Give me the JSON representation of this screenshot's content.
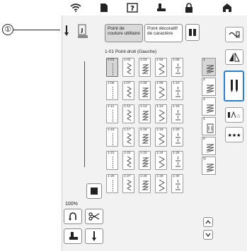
{
  "callout": {
    "number": "①"
  },
  "topbar": {
    "icons": [
      "wifi-icon",
      "sheet-icon",
      "help-icon",
      "presser-foot-icon",
      "lock-icon",
      "home-icon"
    ]
  },
  "tabs": [
    {
      "label": "Point de couture utilitaire",
      "active": true
    },
    {
      "label": "Point décoratif/ de caractère",
      "active": false
    }
  ],
  "stitch_heading": "1-01 Point droit (Gauche)",
  "zoom": "100%",
  "grid": {
    "rows": [
      [
        "1-01",
        "1-02",
        "1-03",
        "1-04",
        "1-05"
      ],
      [
        "1-06",
        "1-07",
        "1-08",
        "1-09",
        "1-10"
      ],
      [
        "1-11",
        "1-12",
        "1-13",
        "1-14",
        "1-15"
      ],
      [
        "1-16",
        "1-17",
        "1-18",
        "1-19",
        "1-20"
      ],
      [
        "1-21",
        "1-22",
        "1-23",
        "1-24",
        "1-25"
      ],
      [
        "1-26",
        "1-27",
        "1-28",
        "1-29",
        "1-30"
      ]
    ],
    "selected": "1-01"
  },
  "right_column": [
    {
      "code": "1",
      "icon": "stitch-pattern-icon"
    },
    {
      "code": "2",
      "icon": "stitch-pattern-icon"
    },
    {
      "code": "3",
      "icon": "stitch-pattern-icon"
    },
    {
      "code": "4",
      "icon": "buttonhole-icon"
    },
    {
      "code": "5",
      "icon": "stitch-pattern-icon"
    },
    {
      "code": "Q",
      "icon": "stitch-pattern-icon"
    }
  ],
  "side_buttons": [
    "thread-icon",
    "mirror-icon",
    "needle-mode-icon",
    "pattern-text-icon",
    "stars-icon"
  ],
  "colors": {
    "accent": "#2a7fd0",
    "background": "#f2f2f2"
  }
}
